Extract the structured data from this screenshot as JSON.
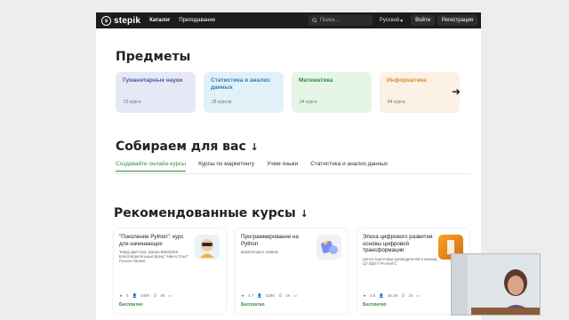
{
  "nav": {
    "logo_text": "stepik",
    "links": [
      "Каталог",
      "Преподавание"
    ],
    "search_placeholder": "Поиск...",
    "language": "Русский",
    "login": "Войти",
    "register": "Регистрация"
  },
  "subjects": {
    "title": "Предметы",
    "cards": [
      {
        "name": "Гуманитарные науки",
        "count": "53 курса",
        "bg": "#e6e8f6",
        "color": "#4a5aa8"
      },
      {
        "name": "Статистика и анализ данных",
        "count": "28 курсов",
        "bg": "#e1f1f8",
        "color": "#2f7fb0"
      },
      {
        "name": "Математика",
        "count": "34 курса",
        "bg": "#e5f5e6",
        "color": "#2f8d3a"
      },
      {
        "name": "Информатика",
        "count": "84 курса",
        "bg": "#fbf1e4",
        "color": "#e08a2a"
      }
    ]
  },
  "collections": {
    "title": "Собираем для вас",
    "tabs": [
      "Создавайте онлайн-курсы",
      "Курсы по маркетингу",
      "Учим языки",
      "Статистика и анализ данных"
    ]
  },
  "recommended": {
    "title": "Рекомендованные курсы",
    "courses": [
      {
        "title": "\"Поколение Python\": курс для начинающих",
        "author": "Тимур Дай Гуев, Школа BEEGEEK, Благотворительный фонд \"Айнео Опыт\", Руслан Чаниев",
        "rating": "5",
        "learners": "248K",
        "hours": "46",
        "price": "Бесплатно"
      },
      {
        "title": "Программирование на Python",
        "author": "Bioinformatics Institute",
        "rating": "4.7",
        "learners": "528K",
        "hours": "19",
        "price": "Бесплатно"
      },
      {
        "title": "Эпоха цифрового развития: основы цифровой трансформации",
        "author": "Центр подготовки руководителей и команд ЦТ ВШГУ РАНХиГС",
        "rating": "4.8",
        "learners": "46.4K",
        "hours": "19",
        "price": "Бесплатно"
      }
    ]
  }
}
